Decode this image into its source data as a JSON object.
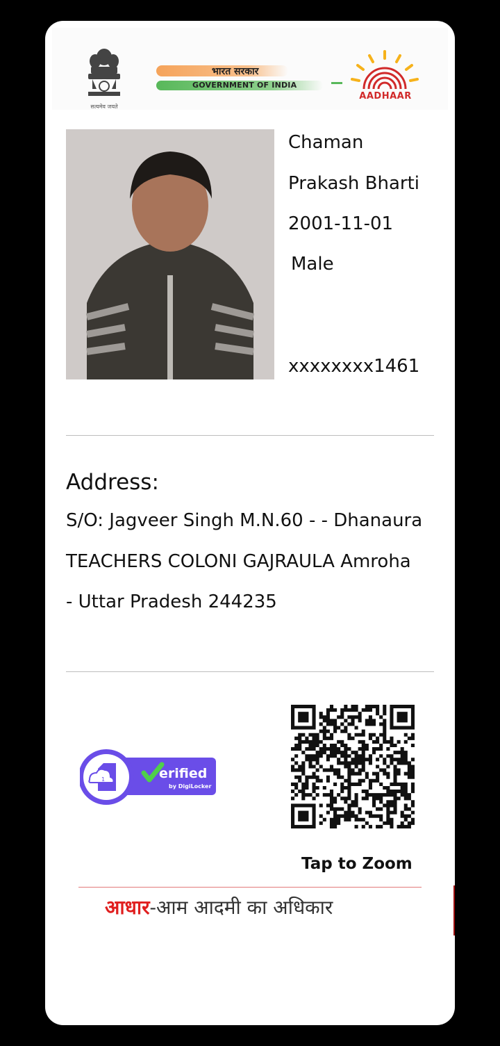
{
  "header": {
    "emblem_caption": "सत्यमेव जयते",
    "gov_hindi": "भारत सरकार",
    "gov_english": "GOVERNMENT OF INDIA",
    "aadhaar_logo_text": "AADHAAR"
  },
  "person": {
    "name_line1": "Chaman",
    "name_line2": "Prakash Bharti",
    "dob": "2001-11-01",
    "gender": "Male",
    "aadhaar_masked": "xxxxxxxx1461"
  },
  "address": {
    "title": "Address:",
    "lines": [
      "S/O: Jagveer Singh M.N.60 - - Dhanaura",
      "TEACHERS COLONI GAJRAULA Amroha",
      "- Uttar Pradesh 244235"
    ]
  },
  "verification": {
    "badge_text": "erified",
    "badge_sub": "by DigiLocker",
    "doc_number": "1"
  },
  "qr": {
    "tap_label": "Tap to Zoom"
  },
  "footer": {
    "tagline_red": "आधार",
    "tagline_rest": "-आम आदमी का अधिकार"
  },
  "colors": {
    "accent_red": "#e01e1e",
    "digilocker_purple": "#6a4de8",
    "saffron": "#f5a35a",
    "green": "#58b85a"
  }
}
